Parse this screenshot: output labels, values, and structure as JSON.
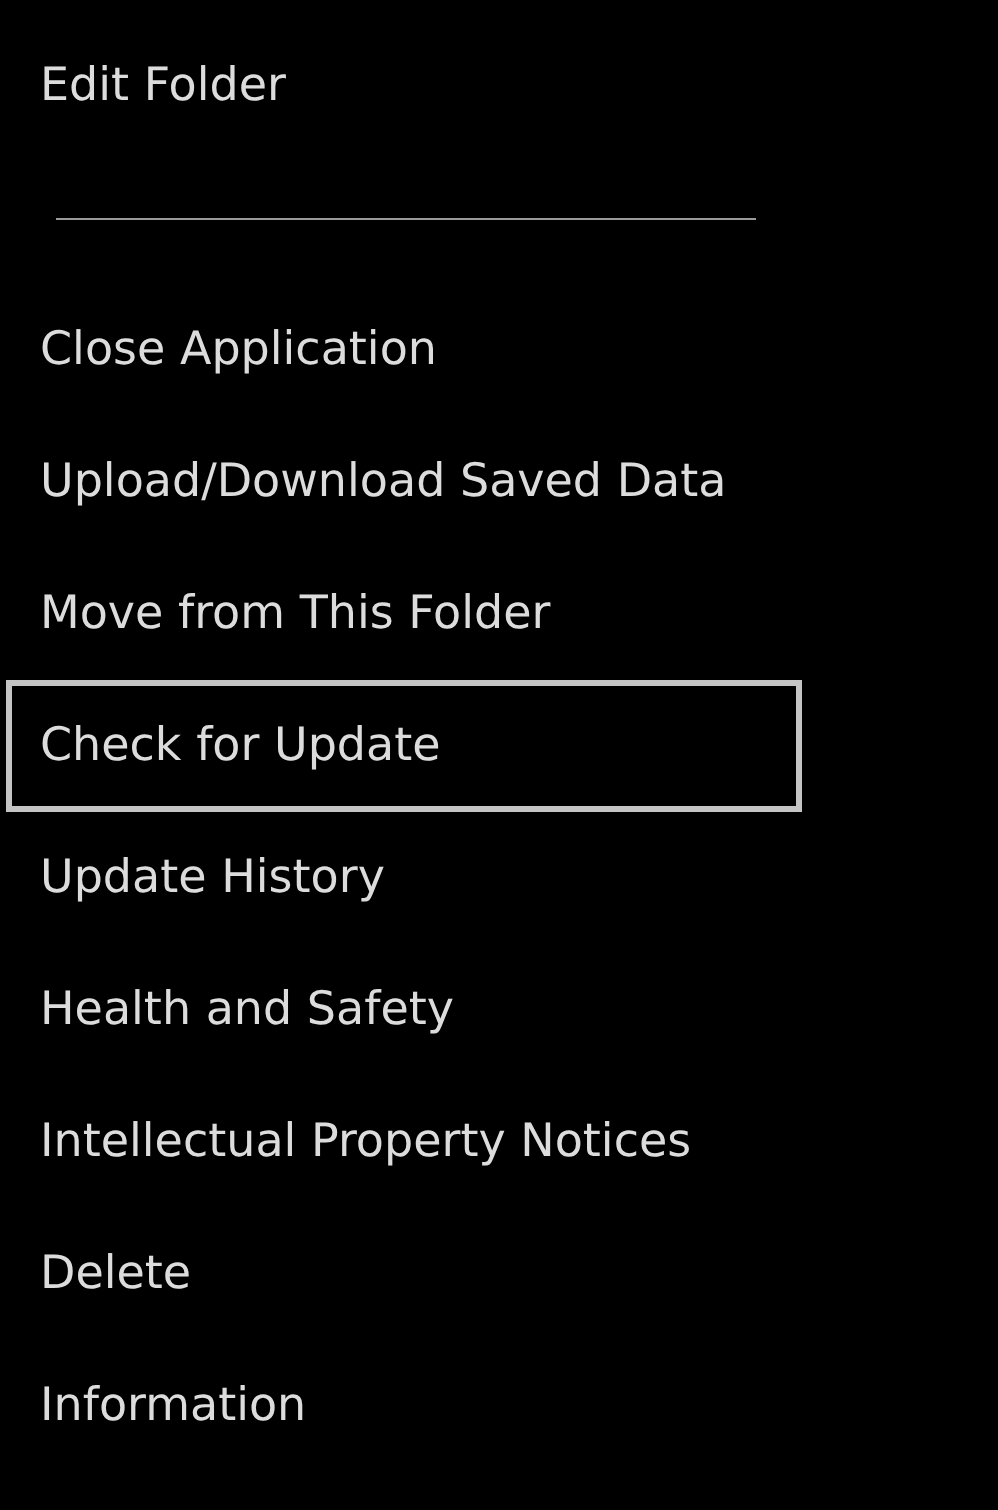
{
  "folder_menu": {
    "items": [
      {
        "label": "Edit Folder",
        "selected": false
      }
    ]
  },
  "app_menu": {
    "items": [
      {
        "label": "Close Application",
        "selected": false
      },
      {
        "label": "Upload/Download Saved Data",
        "selected": false
      },
      {
        "label": "Move from This Folder",
        "selected": false
      },
      {
        "label": "Check for Update",
        "selected": true
      },
      {
        "label": "Update History",
        "selected": false
      },
      {
        "label": "Health and Safety",
        "selected": false
      },
      {
        "label": "Intellectual Property Notices",
        "selected": false
      },
      {
        "label": "Delete",
        "selected": false
      },
      {
        "label": "Information",
        "selected": false
      }
    ]
  }
}
